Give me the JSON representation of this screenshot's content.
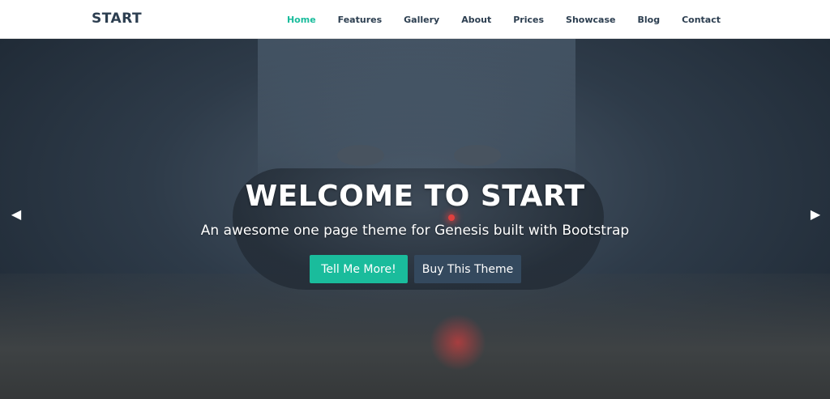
{
  "navbar": {
    "brand": "START",
    "items": [
      {
        "label": "Home",
        "active": true
      },
      {
        "label": "Features",
        "active": false
      },
      {
        "label": "Gallery",
        "active": false
      },
      {
        "label": "About",
        "active": false
      },
      {
        "label": "Prices",
        "active": false
      },
      {
        "label": "Showcase",
        "active": false
      },
      {
        "label": "Blog",
        "active": false
      },
      {
        "label": "Contact",
        "active": false
      }
    ]
  },
  "hero": {
    "title": "WELCOME TO START",
    "subtitle": "An awesome one page theme for Genesis built with Bootstrap",
    "primary_button": "Tell Me More!",
    "secondary_button": "Buy This Theme",
    "prev_icon": "chevron-left-icon",
    "next_icon": "chevron-right-icon"
  },
  "colors": {
    "accent": "#1abc9c",
    "dark": "#2c3e50",
    "secondary_button": "#34495e"
  }
}
